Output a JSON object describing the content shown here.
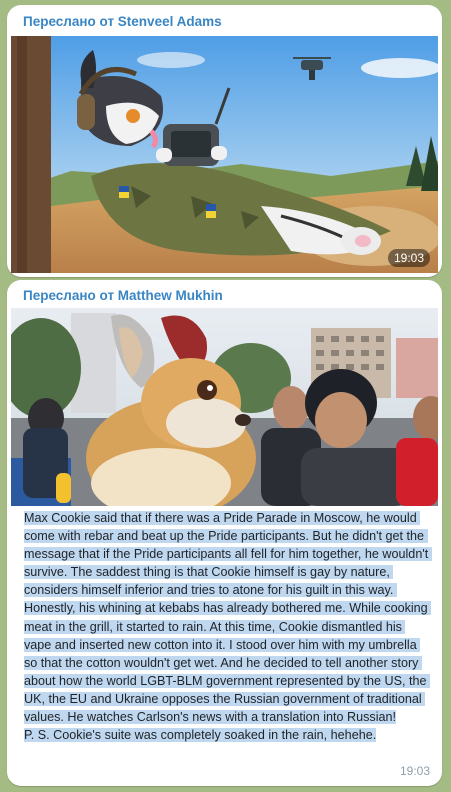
{
  "messages": [
    {
      "forwarded_from": "Переслано от Stenveel Adams",
      "time": "19:03",
      "image": "illustration of a furry wolf character in military camouflage lying down holding a drone controller"
    },
    {
      "forwarded_from": "Переслано от Matthew Mukhin",
      "time": "19:03",
      "image": "street photo of a person in an orange fox fursuit head among a crowd",
      "text": "Max Cookie said that if there was a Pride Parade in Moscow, he would come with rebar and beat up the Pride participants. But he didn't get the message that if the Pride participants all fell for him together, he wouldn't survive. The saddest thing is that Cookie himself is gay by nature, considers himself inferior and tries to atone for his guilt in this way. Honestly, his whining at kebabs has already bothered me. While cooking meat in the grill, it started to rain. At this time, Cookie dismantled his vape and inserted new cotton into it. I stood over him with my umbrella so that the cotton wouldn't get wet. And he decided to tell another story about how the world LGBT-BLM government represented by the US, the UK, the EU and Ukraine opposes the Russian government of traditional values. He watches Carlson's news with a translation into Russian!\nP. S. Cookie's suite was completely soaked in the rain, hehehe."
    }
  ]
}
